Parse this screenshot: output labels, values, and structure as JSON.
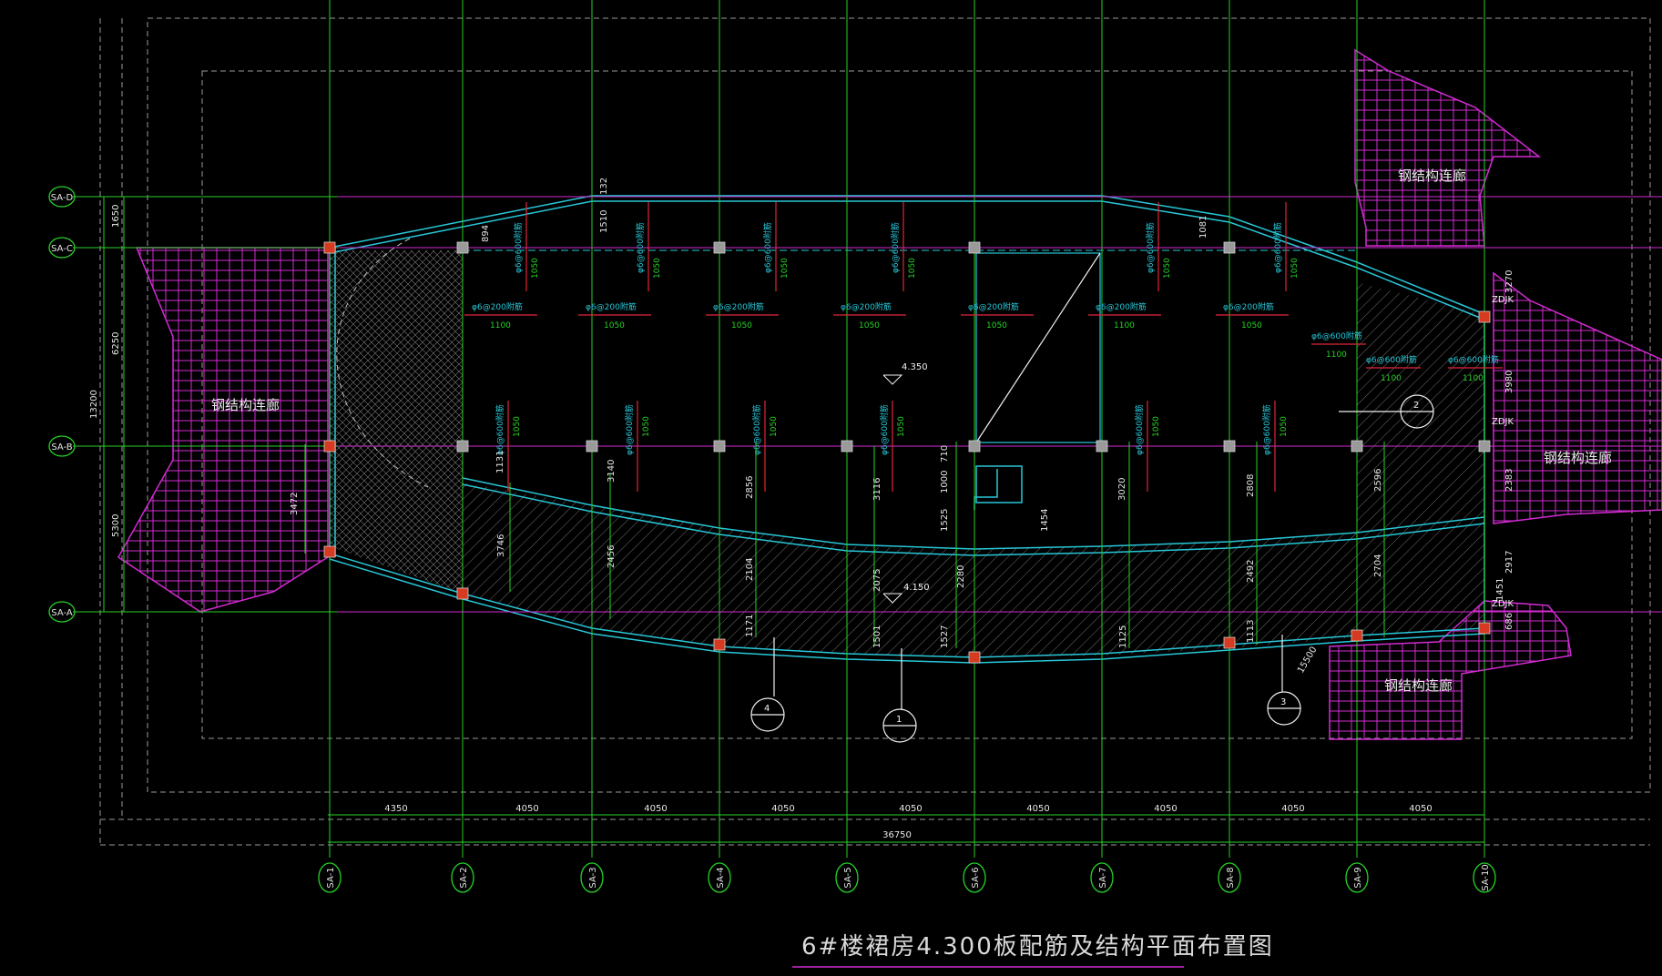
{
  "drawing": {
    "title": "6#楼裙房4.300板配筋及结构平面布置图"
  },
  "grid": {
    "columns": [
      "SA-1",
      "SA-2",
      "SA-3",
      "SA-4",
      "SA-5",
      "SA-6",
      "SA-7",
      "SA-8",
      "SA-9",
      "SA-10"
    ],
    "rows": [
      "SA-D",
      "SA-C",
      "SA-B",
      "SA-A"
    ],
    "column_spacings": [
      "4350",
      "4050",
      "4050",
      "4050",
      "4050",
      "4050",
      "4050",
      "4050",
      "4050"
    ],
    "total_width": "36750",
    "row_dims": [
      "1650",
      "6250",
      "5300"
    ],
    "total_height": "13200"
  },
  "labels": {
    "corridor": "钢结构连廊",
    "elev_main": "4.350",
    "elev_low": "4.150",
    "joint_tag": "ZDJK",
    "section_numbers": [
      "4",
      "1",
      "3",
      "2"
    ]
  },
  "rebar": {
    "top_spec": "φ6@600附筋",
    "mid_spec": "φ6@200附筋",
    "len_a": "1050",
    "len_b": "1100"
  },
  "dims": {
    "bay_depths": [
      "3746",
      "3140",
      "2856",
      "3116",
      "3020",
      "2808",
      "2596"
    ],
    "lower_strip": [
      "3746",
      "2456",
      "2104",
      "2075",
      "2280",
      "2492",
      "2704"
    ],
    "edge_bits": [
      "1171",
      "1501",
      "1527",
      "1125",
      "1113",
      "1451"
    ],
    "misc": [
      "132",
      "1510",
      "1081",
      "1131",
      "1000",
      "1525",
      "710",
      "1454",
      "3472",
      "894",
      "3270",
      "3980",
      "2383",
      "2917",
      "686",
      "15500"
    ]
  },
  "colors": {
    "background": "#000000",
    "grid_line": "#27d127",
    "hatch": "#d22bd2",
    "beam": "#27c7d8",
    "rebar": "#e0263a",
    "column": "#d63a20",
    "text": "#e6e6e6"
  }
}
